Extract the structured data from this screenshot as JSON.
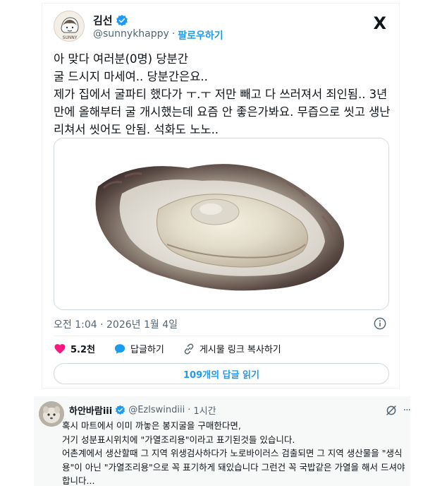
{
  "post": {
    "author_name": "김선",
    "handle": "@sunnykhappy",
    "separator": "·",
    "follow_label": "팔로우하기",
    "avatar_text": "SUNNY",
    "platform_logo": "X",
    "text": "아 맞다 여러분(0명) 당분간\n굴 드시지 마세여.. 당분간은요..\n제가 집에서 굴파티 했다가 ㅜ.ㅜ 저만 빼고 다 쓰러져서 죄인됨.. 3년만에 올해부터 굴 개시했는데 요즘 안 좋은가봐요. 무즙으로 씻고 생난리쳐서 씻어도 안됨. 석화도 노노..",
    "timestamp": "오전 1:04 · 2026년 1월 4일",
    "like_count": "5.2천",
    "reply_label": "답글하기",
    "copy_link_label": "게시물 링크 복사하기",
    "read_replies_label": "109개의 답글 읽기"
  },
  "reply": {
    "author_name": "하안바람iii",
    "handle": "@Ezlswindiii",
    "separator": "·",
    "time": "1시간",
    "more": "···",
    "text": "혹시 마트에서 이미 까놓은 봉지굴을 구매한다면,\n거기 성분표시위치에 \"가열조리용\"이라고 표기된것들 있습니다.\n어촌계에서 생산할때 그 지역 위생검사하다가 노로바이러스 검출되면 그 지역 생산물을 \"생식용\"이 아닌 \"가열조리용\"으로 꼭 표기하게 돼있습니다 그런건 꼭 국밥같은 가열을 해서 드셔야합니다..."
  },
  "colors": {
    "accent": "#1d9bf0",
    "like": "#f91880",
    "text_secondary": "#536471"
  },
  "icons": [
    "verified-badge-icon",
    "x-logo-icon",
    "info-icon",
    "heart-icon",
    "reply-bubble-icon",
    "link-icon",
    "grok-icon"
  ]
}
